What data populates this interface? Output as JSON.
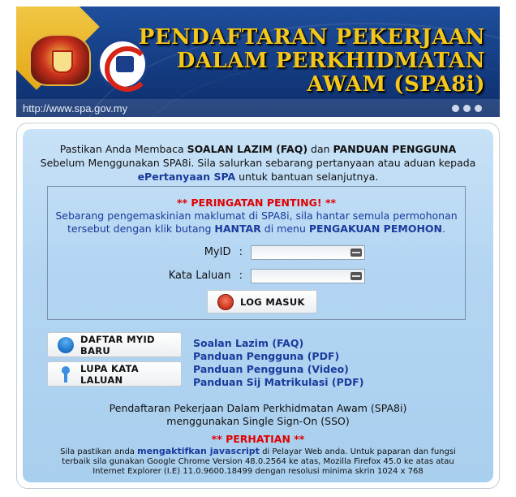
{
  "banner": {
    "title_line1": "PENDAFTARAN PEKERJAAN",
    "title_line2": "DALAM PERKHIDMATAN",
    "title_line3": "AWAM (SPA8i)",
    "url": "http://www.spa.gov.my"
  },
  "intro": {
    "line1_pre": "Pastikan Anda Membaca ",
    "faq": "SOALAN LAZIM (FAQ)",
    "line1_mid": " dan ",
    "guide": "PANDUAN PENGGUNA",
    "line2": "Sebelum Menggunakan SPA8i. Sila salurkan sebarang pertanyaan atau aduan kepada",
    "epertanyaan": "ePertanyaan SPA",
    "line3_post": " untuk bantuan selanjutnya."
  },
  "warning": {
    "title": "** PERINGATAN PENTING! **",
    "line1": "Sebarang pengemaskinian maklumat di SPA8i, sila hantar semula permohonan",
    "line2_pre": "tersebut dengan klik butang ",
    "hantar": "HANTAR",
    "line2_mid": " di menu ",
    "pengakuan": "PENGAKUAN PEMOHON",
    "line2_post": "."
  },
  "login": {
    "myid_label": "MyID",
    "password_label": "Kata Laluan",
    "colon": ":",
    "myid_value": "",
    "password_value": "",
    "login_button": "LOG MASUK"
  },
  "actions": {
    "register_button": "DAFTAR MYID BARU",
    "forgot_button": "LUPA KATA LALUAN"
  },
  "links": [
    "Soalan Lazim (FAQ)",
    "Panduan Pengguna (PDF)",
    "Panduan Pengguna (Video)",
    "Panduan Sij Matrikulasi (PDF)"
  ],
  "sso": {
    "line1": "Pendaftaran Pekerjaan Dalam Perkhidmatan Awam (SPA8i)",
    "line2": "menggunakan Single Sign-On (SSO)"
  },
  "attention": {
    "title": "** PERHATIAN **",
    "line1_pre": "Sila pastikan anda ",
    "js": "mengaktifkan javascript",
    "line1_post": " di Pelayar Web anda. Untuk paparan dan fungsi",
    "line2": "terbaik sila gunakan Google Chrome Version 48.0.2564 ke atas, Mozilla Firefox 45.0 ke atas atau",
    "line3": "Internet Explorer (I.E) 11.0.9600.18499 dengan resolusi minima skrin 1024 x 768"
  },
  "colors": {
    "title_gold": "#f5c71a",
    "banner_blue": "#163f86",
    "link_blue": "#1a3b9c",
    "alert_red": "#e00000",
    "panel_blue": "#b3d5f2"
  }
}
